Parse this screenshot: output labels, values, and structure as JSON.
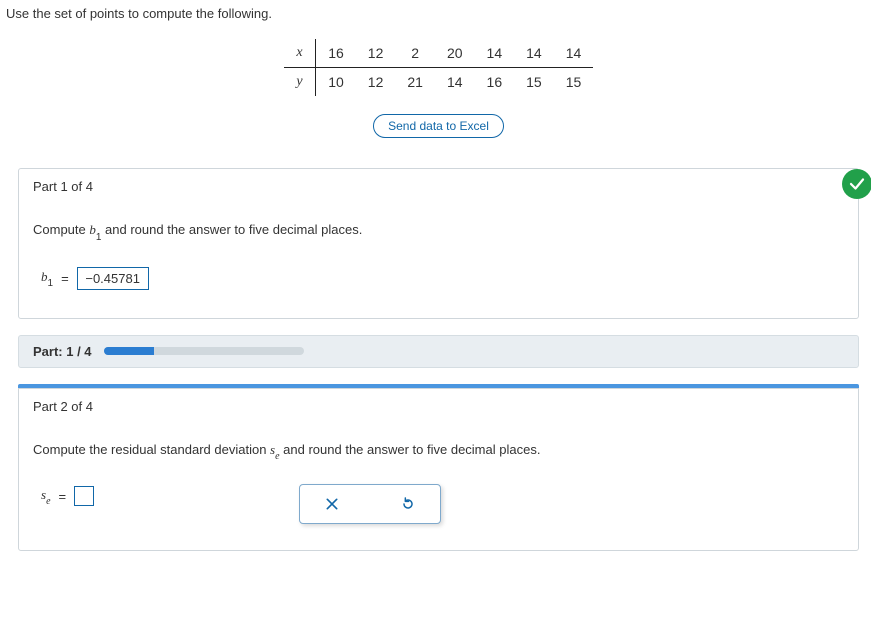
{
  "prompt": "Use the set of points to compute the following.",
  "table": {
    "xlabel": "x",
    "ylabel": "y",
    "x": [
      "16",
      "12",
      "2",
      "20",
      "14",
      "14",
      "14"
    ],
    "y": [
      "10",
      "12",
      "21",
      "14",
      "16",
      "15",
      "15"
    ]
  },
  "excel_btn": "Send data to Excel",
  "part1": {
    "header": "Part 1 of 4",
    "instr_pre": "Compute ",
    "instr_var": "b",
    "instr_sub": "1",
    "instr_post": " and round the answer to five decimal places.",
    "ans_var": "b",
    "ans_sub": "1",
    "eq": "=",
    "ans_value": "−0.45781"
  },
  "progress": {
    "label": "Part: 1 / 4",
    "percent": 25
  },
  "part2": {
    "header": "Part 2 of 4",
    "instr_pre": "Compute the residual standard deviation ",
    "instr_var": "s",
    "instr_sub": "e",
    "instr_post": " and round the answer to five decimal places.",
    "ans_var": "s",
    "ans_sub": "e",
    "eq": "="
  },
  "chart_data": {
    "type": "table",
    "columns": [
      "x",
      "y"
    ],
    "rows": [
      [
        16,
        10
      ],
      [
        12,
        12
      ],
      [
        2,
        21
      ],
      [
        20,
        14
      ],
      [
        14,
        16
      ],
      [
        14,
        15
      ],
      [
        14,
        15
      ]
    ]
  }
}
